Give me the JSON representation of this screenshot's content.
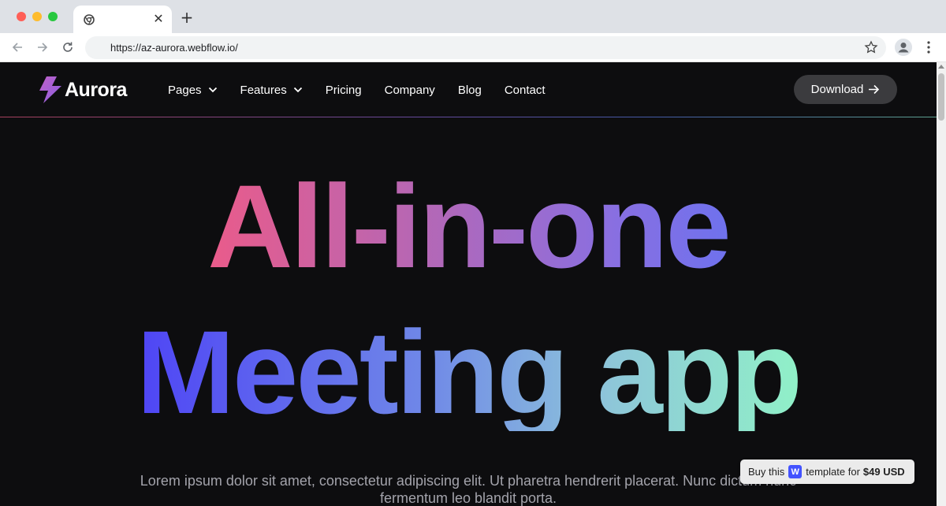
{
  "browser": {
    "url": "https://az-aurora.webflow.io/",
    "tab_close_glyph": "✕",
    "new_tab_glyph": "+"
  },
  "site": {
    "logo_text": "Aurora",
    "nav": {
      "items": [
        {
          "label": "Pages",
          "dropdown": true
        },
        {
          "label": "Features",
          "dropdown": true
        },
        {
          "label": "Pricing",
          "dropdown": false
        },
        {
          "label": "Company",
          "dropdown": false
        },
        {
          "label": "Blog",
          "dropdown": false
        },
        {
          "label": "Contact",
          "dropdown": false
        }
      ],
      "download_label": "Download"
    },
    "hero": {
      "line1": "All-in-one",
      "line2": "Meeting app",
      "description": "Lorem ipsum dolor sit amet, consectetur adipiscing elit. Ut pharetra hendrerit placerat. Nunc dictum nunc fermentum leo blandit porta."
    },
    "badge": {
      "prefix": "Buy this",
      "logo_letter": "W",
      "suffix": "template for",
      "price": "$49 USD"
    },
    "colors": {
      "background": "#0d0d0f",
      "gradient_pink": "#ef5a86",
      "gradient_purple": "#8a6fe0",
      "gradient_blue": "#4f46f5",
      "gradient_mint": "#90f0c8",
      "button_bg": "#3b3b3e",
      "webflow_blue": "#4353ff"
    }
  }
}
